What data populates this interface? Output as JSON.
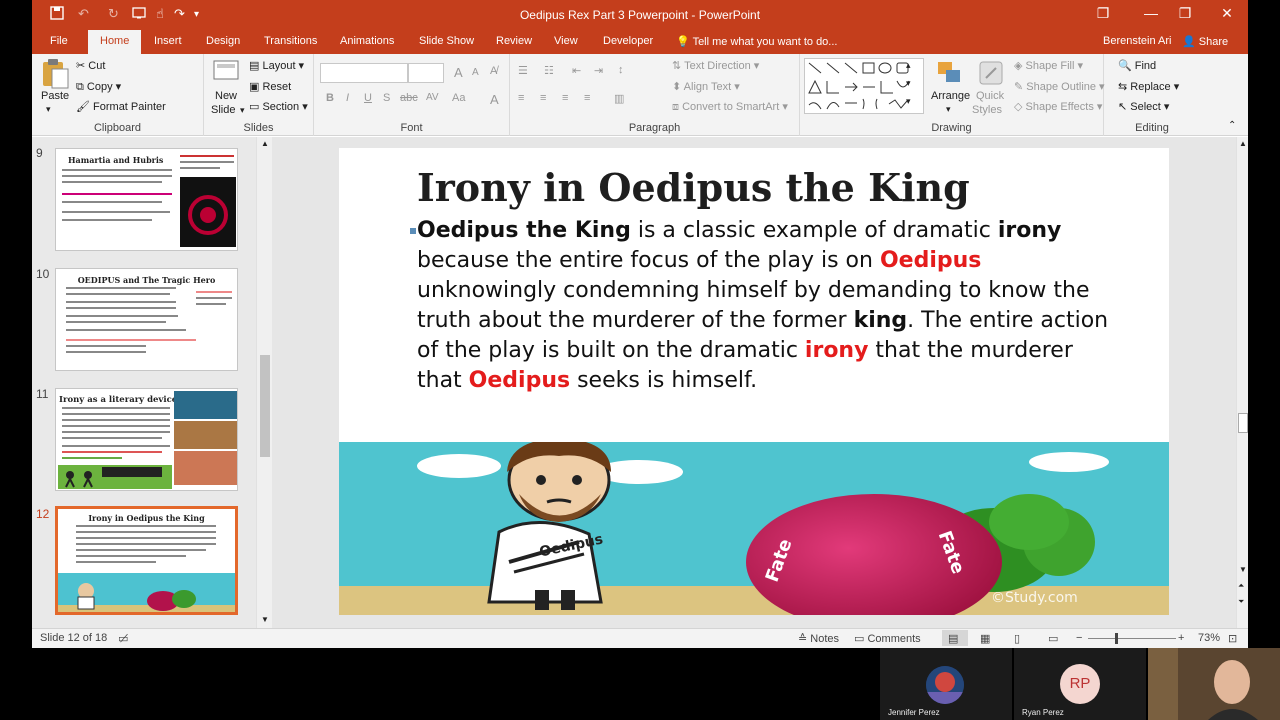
{
  "titlebar": {
    "title": "Oedipus Rex Part 3 Powerpoint  -  PowerPoint",
    "restore_glyph": "❐",
    "minimize_glyph": "—",
    "maximize_glyph": "❐",
    "close_glyph": "✕"
  },
  "tabs": [
    {
      "label": "File"
    },
    {
      "label": "Home"
    },
    {
      "label": "Insert"
    },
    {
      "label": "Design"
    },
    {
      "label": "Transitions"
    },
    {
      "label": "Animations"
    },
    {
      "label": "Slide Show"
    },
    {
      "label": "Review"
    },
    {
      "label": "View"
    },
    {
      "label": "Developer"
    }
  ],
  "tell_me": "Tell me what you want to do...",
  "user": "Berenstein Ari",
  "share": "Share",
  "ribbon": {
    "clipboard": {
      "paste": "Paste",
      "cut": "Cut",
      "copy": "Copy",
      "format_painter": "Format Painter",
      "label": "Clipboard"
    },
    "slides": {
      "new_slide_line1": "New",
      "new_slide_line2": "Slide",
      "layout": "Layout",
      "reset": "Reset",
      "section": "Section",
      "label": "Slides"
    },
    "font": {
      "label": "Font",
      "bold": "B",
      "italic": "I",
      "underline": "U",
      "strike": "S",
      "abc": "abc",
      "av": "AV",
      "aa": "Aa",
      "a_color": "A",
      "grow": "A",
      "shrink": "A"
    },
    "paragraph": {
      "label": "Paragraph",
      "text_direction": "Text Direction",
      "align_text": "Align Text",
      "convert_smartart": "Convert to SmartArt"
    },
    "drawing": {
      "label": "Drawing",
      "arrange": "Arrange",
      "quick_styles_line1": "Quick",
      "quick_styles_line2": "Styles",
      "shape_fill": "Shape Fill",
      "shape_outline": "Shape Outline",
      "shape_effects": "Shape Effects"
    },
    "editing": {
      "label": "Editing",
      "find": "Find",
      "replace": "Replace",
      "select": "Select"
    }
  },
  "thumbnails": [
    {
      "num": "9",
      "title": "Hamartia and Hubris"
    },
    {
      "num": "10",
      "title": "OEDIPUS and The Tragic Hero"
    },
    {
      "num": "11",
      "title": "Irony as a literary device"
    },
    {
      "num": "12",
      "title": "Irony in Oedipus the King"
    }
  ],
  "slide": {
    "title": "Irony in Oedipus the King",
    "body": {
      "p1": "Oedipus the King",
      "p2": " is a classic example of dramatic ",
      "p3": "irony",
      "p4": " because the entire focus of the play is on ",
      "p5": "Oedipus",
      "p6": " unknowingly condemning himself by demanding to know the truth about the murderer of the former ",
      "p7": "king",
      "p8": ". The entire action of the play is built on the dramatic ",
      "p9": "irony",
      "p10": " that the murderer that ",
      "p11": "Oedipus",
      "p12": " seeks is himself."
    },
    "image": {
      "shirt_text": "Oedipus",
      "ball_text": "Fate",
      "ball_text2": "Fate",
      "watermark": "©Study.com"
    }
  },
  "status": {
    "slide_count": "Slide 12 of 18",
    "notes": "Notes",
    "comments": "Comments",
    "zoom": "73%",
    "zoom_minus": "−",
    "zoom_plus": "+"
  },
  "video": {
    "participant1": "Jennifer Perez",
    "participant2": "Ryan Perez",
    "participant2_initials": "RP"
  },
  "colors": {
    "accent": "#c43e1c",
    "highlight_red": "#e41c1c",
    "thumb_selected": "#e3682b"
  }
}
